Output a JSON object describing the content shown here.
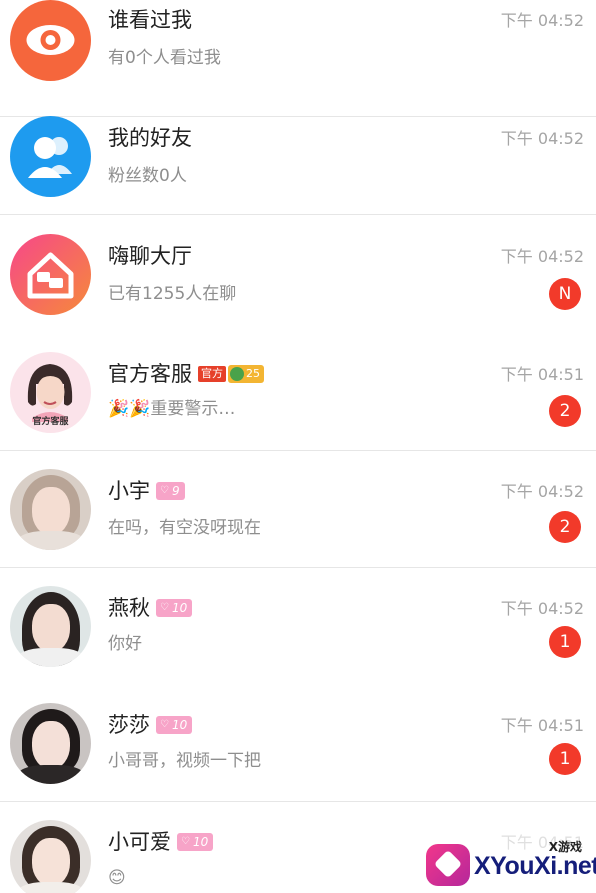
{
  "conversations": [
    {
      "name": "谁看过我",
      "subtitle": "有0个人看过我",
      "time": "下午 04:52",
      "avatar_icon": "eye-icon",
      "avatar_color": "#f5663c"
    },
    {
      "name": "我的好友",
      "subtitle": "粉丝数0人",
      "time": "下午 04:52",
      "avatar_icon": "friends-icon",
      "avatar_color": "#1e9bef"
    },
    {
      "name": "嗨聊大厅",
      "subtitle": "已有1255人在聊",
      "time": "下午 04:52",
      "badge": "N",
      "avatar_icon": "chat-house-icon",
      "avatar_color": "#f2594e"
    },
    {
      "name": "官方客服",
      "tag_official": "官方",
      "tag_level": "25",
      "subtitle": "🎉🎉重要警示…",
      "time": "下午 04:51",
      "badge": "2",
      "avatar_caption": "官方客服",
      "avatar_icon": "customer-service-avatar"
    },
    {
      "name": "小宇",
      "tag_heart": "9",
      "subtitle": "在吗，有空没呀现在",
      "time": "下午 04:52",
      "badge": "2",
      "avatar_icon": "user-photo-avatar"
    },
    {
      "name": "燕秋",
      "tag_heart": "10",
      "subtitle": "你好",
      "time": "下午 04:52",
      "badge": "1",
      "avatar_icon": "user-photo-avatar"
    },
    {
      "name": "莎莎",
      "tag_heart": "10",
      "subtitle": "小哥哥，视频一下把",
      "time": "下午 04:51",
      "badge": "1",
      "avatar_icon": "user-photo-avatar"
    },
    {
      "name": "小可爱",
      "tag_heart": "10",
      "subtitle": "😊",
      "time": "下午 04:51",
      "avatar_icon": "user-photo-avatar"
    }
  ],
  "watermark": {
    "small": "X游戏",
    "big": "XYouXi.net"
  },
  "colors": {
    "badge": "#f23a2a",
    "heart_tag": "#f7a4c8",
    "official_tag": "#e6402a"
  }
}
